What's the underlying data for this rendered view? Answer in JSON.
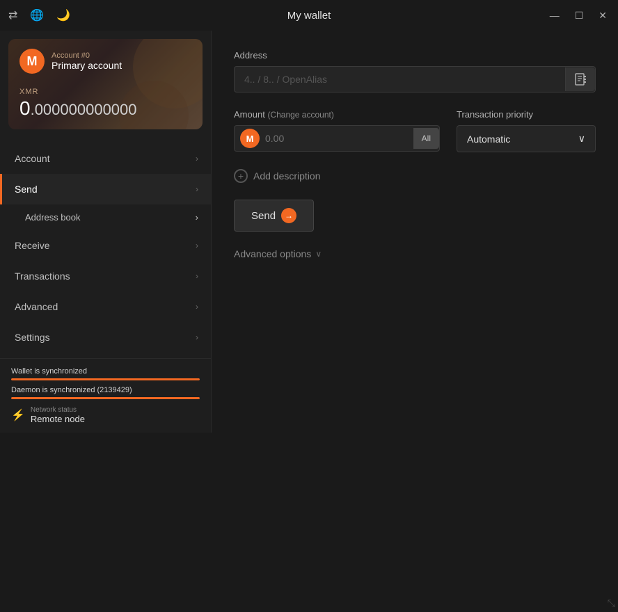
{
  "titlebar": {
    "title": "My wallet",
    "icons": {
      "transfer": "⇄",
      "globe": "🌐",
      "moon": "🌙"
    },
    "controls": {
      "minimize": "—",
      "maximize": "☐",
      "close": "✕"
    }
  },
  "sidebar": {
    "account_card": {
      "account_number": "Account #0",
      "account_name": "Primary account",
      "balance_label": "XMR",
      "balance_integer": "0",
      "balance_decimal": ".000000000000"
    },
    "nav_items": [
      {
        "id": "account",
        "label": "Account",
        "active": false,
        "has_sub": false
      },
      {
        "id": "send",
        "label": "Send",
        "active": true,
        "has_sub": true
      },
      {
        "id": "address-book",
        "label": "Address book",
        "active": false,
        "is_sub": true
      },
      {
        "id": "receive",
        "label": "Receive",
        "active": false,
        "has_sub": false
      },
      {
        "id": "transactions",
        "label": "Transactions",
        "active": false,
        "has_sub": false
      },
      {
        "id": "advanced",
        "label": "Advanced",
        "active": false,
        "has_sub": false
      },
      {
        "id": "settings",
        "label": "Settings",
        "active": false,
        "has_sub": false
      }
    ],
    "footer": {
      "wallet_sync_label": "Wallet is synchronized",
      "wallet_sync_percent": 100,
      "daemon_sync_label": "Daemon is synchronized (2139429)",
      "daemon_sync_percent": 100,
      "network_label": "Network status",
      "network_value": "Remote node"
    }
  },
  "main": {
    "address_label": "Address",
    "address_placeholder": "4.. / 8.. / OpenAlias",
    "address_book_btn_label": "📋",
    "amount_label": "Amount",
    "change_account_label": "(Change account)",
    "amount_placeholder": "0.00",
    "all_btn_label": "All",
    "priority_label": "Transaction priority",
    "priority_value": "Automatic",
    "add_description_label": "Add description",
    "send_btn_label": "Send",
    "advanced_options_label": "Advanced options"
  }
}
